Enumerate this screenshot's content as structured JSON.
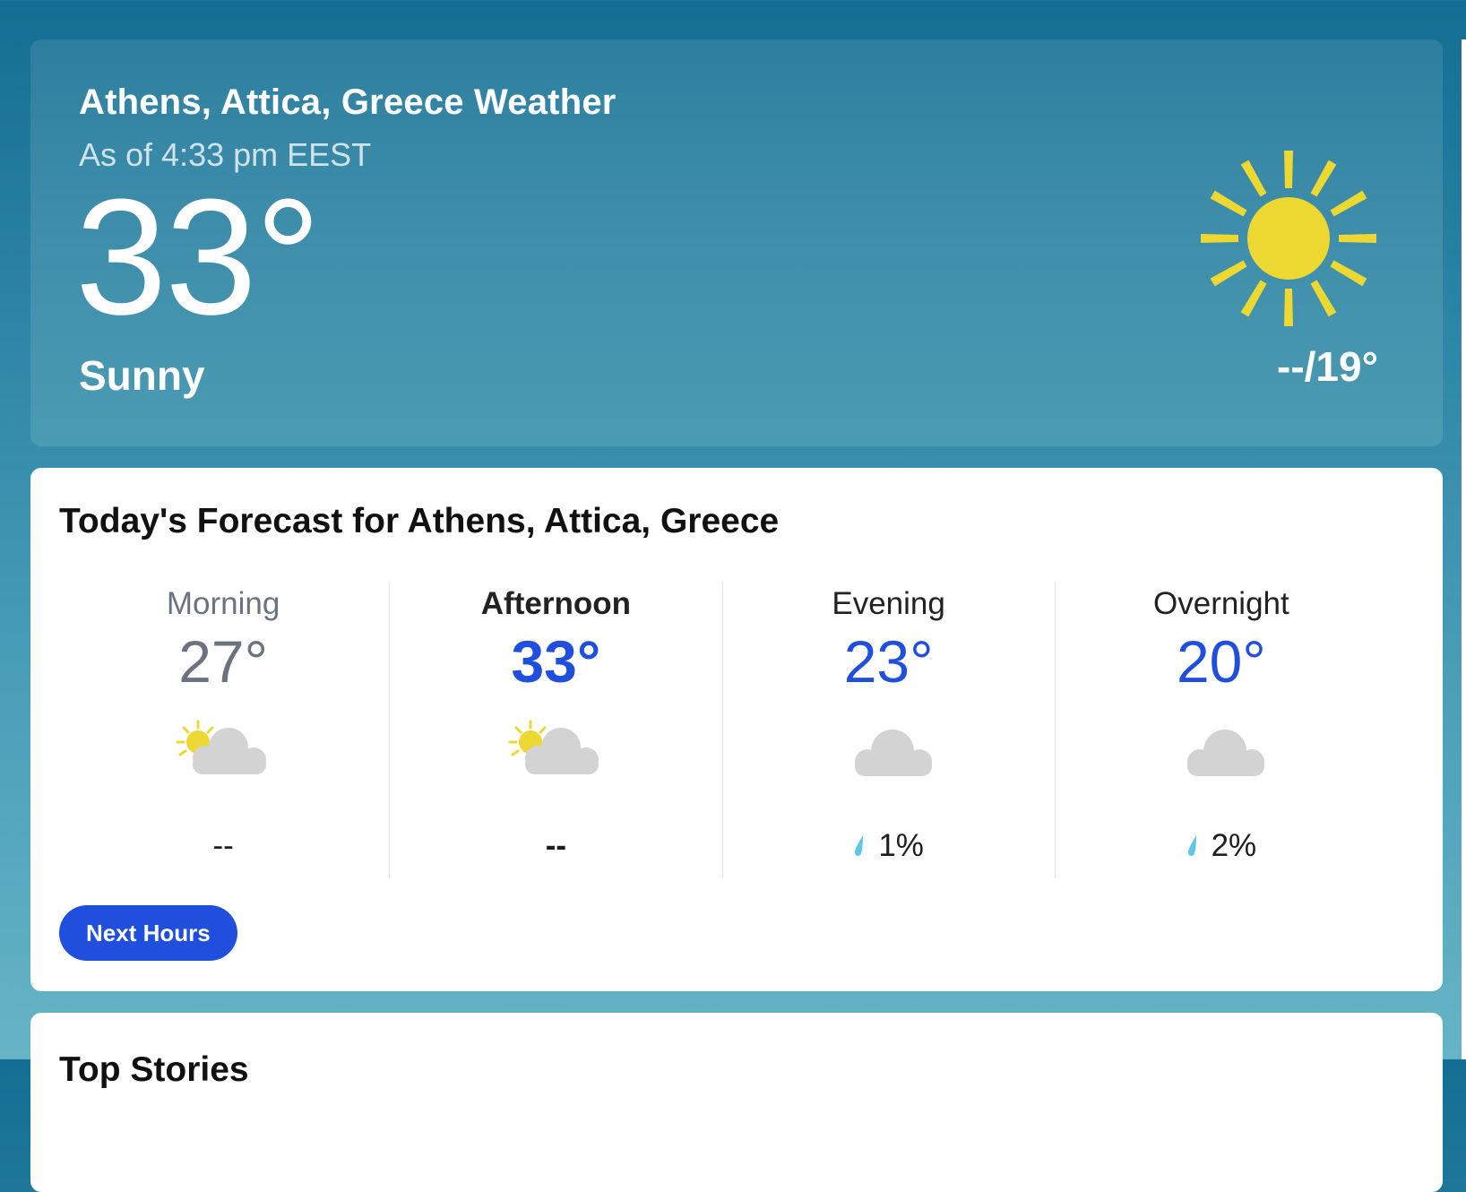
{
  "hero": {
    "location_title": "Athens, Attica, Greece Weather",
    "as_of": "As of 4:33 pm EEST",
    "temperature": "33°",
    "condition": "Sunny",
    "condition_icon": "sun-icon",
    "hi_lo": "--/19°"
  },
  "forecast": {
    "title": "Today's Forecast for Athens, Attica, Greece",
    "periods": [
      {
        "name": "Morning",
        "temp": "27°",
        "icon": "partly-cloudy-icon",
        "precip": "--",
        "name_color": "#6b7280",
        "temp_color": "#6b7280",
        "active": false
      },
      {
        "name": "Afternoon",
        "temp": "33°",
        "icon": "partly-cloudy-icon",
        "precip": "--",
        "name_color": "#222222",
        "temp_color": "#1f4fdc",
        "active": true
      },
      {
        "name": "Evening",
        "temp": "23°",
        "icon": "cloud-icon",
        "precip": "1%",
        "name_color": "#222222",
        "temp_color": "#1f4fdc",
        "active": false
      },
      {
        "name": "Overnight",
        "temp": "20°",
        "icon": "cloud-icon",
        "precip": "2%",
        "name_color": "#222222",
        "temp_color": "#1f4fdc",
        "active": false
      }
    ],
    "next_hours_label": "Next Hours"
  },
  "stories": {
    "title": "Top Stories"
  },
  "colors": {
    "accent": "#1f4fdc",
    "sun": "#ecd830",
    "cloud": "#d3d3d3",
    "raindrop": "#5bc8e8"
  }
}
